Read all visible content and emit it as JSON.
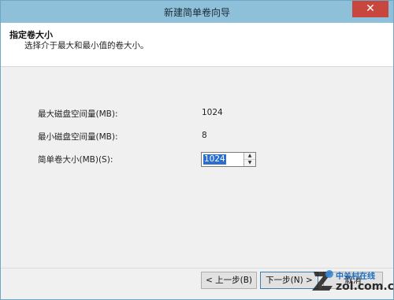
{
  "window": {
    "title": "新建简单卷向导",
    "close_glyph": "✕"
  },
  "header": {
    "title": "指定卷大小",
    "subtitle": "选择介于最大和最小值的卷大小。"
  },
  "fields": {
    "max_label": "最大磁盘空间量(MB):",
    "max_value": "1024",
    "min_label": "最小磁盘空间量(MB):",
    "min_value": "8",
    "size_label": "简单卷大小(MB)(S):",
    "size_value": "1024"
  },
  "buttons": {
    "back": "< 上一步(B)",
    "next": "下一步(N) >",
    "cancel": "取消"
  },
  "watermark": {
    "cn": "中关村在线",
    "en": "zol.com.cn"
  },
  "colors": {
    "titlebar": "#8ec0d9",
    "close": "#c7473f",
    "selection": "#2a6ecf"
  }
}
